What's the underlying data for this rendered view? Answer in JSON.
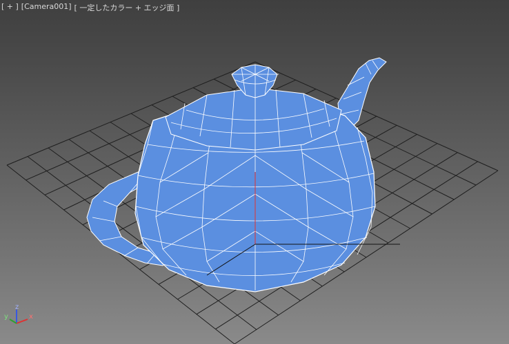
{
  "viewport": {
    "label_menu": "[ + ]",
    "label_camera": "[Camera001]",
    "label_shading": "[ 一定したカラー + エッジ面 ]"
  },
  "axis_tripod": {
    "x_label": "x",
    "y_label": "y",
    "z_label": "z"
  },
  "colors": {
    "object_fill": "#5b8fe0",
    "wire": "#ffffff",
    "grid": "#1e1e1e",
    "axis_x": "#e03030",
    "axis_y": "#2ea02e",
    "axis_z": "#3858e0"
  }
}
